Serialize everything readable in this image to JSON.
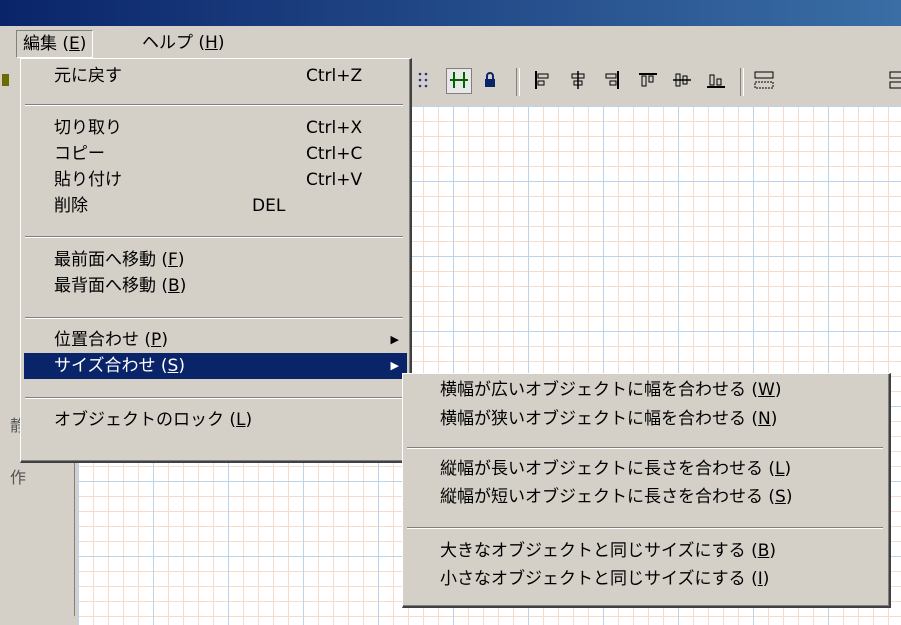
{
  "menubar": {
    "edit": {
      "label": "編集 (",
      "key": "E",
      "suffix": ")"
    },
    "help": {
      "label": "ヘルプ (",
      "key": "H",
      "suffix": ")"
    }
  },
  "toolbar": {
    "icons": [
      "grid-snap-icon",
      "fit-to-grid-icon",
      "lock-icon",
      "align-left-icon",
      "align-center-icon",
      "align-right-icon",
      "align-top-icon",
      "align-middle-icon",
      "align-bottom-icon",
      "same-size-icon"
    ]
  },
  "left_panel": {
    "text1": "静",
    "text2": "作"
  },
  "edit_menu": {
    "undo": {
      "label": "元に戻す",
      "shortcut": "Ctrl+Z"
    },
    "cut": {
      "label": "切り取り",
      "shortcut": "Ctrl+X"
    },
    "copy": {
      "label": "コピー",
      "shortcut": "Ctrl+C"
    },
    "paste": {
      "label": "貼り付け",
      "shortcut": "Ctrl+V"
    },
    "delete": {
      "label": "削除",
      "shortcut": "DEL"
    },
    "bring_front": {
      "label": "最前面へ移動 (",
      "key": "F",
      "suffix": ")"
    },
    "send_back": {
      "label": "最背面へ移動 (",
      "key": "B",
      "suffix": ")"
    },
    "align": {
      "label": "位置合わせ (",
      "key": "P",
      "suffix": ")"
    },
    "size_match": {
      "label": "サイズ合わせ (",
      "key": "S",
      "suffix": ")"
    },
    "lock": {
      "label": "オブジェクトのロック (",
      "key": "L",
      "suffix": ")"
    }
  },
  "size_submenu": {
    "width_wide": {
      "label": "横幅が広いオブジェクトに幅を合わせる (",
      "key": "W",
      "suffix": ")"
    },
    "width_narrow": {
      "label": "横幅が狭いオブジェクトに幅を合わせる (",
      "key": "N",
      "suffix": ")"
    },
    "height_long": {
      "label": "縦幅が長いオブジェクトに長さを合わせる (",
      "key": "L",
      "suffix": ")"
    },
    "height_short": {
      "label": "縦幅が短いオブジェクトに長さを合わせる (",
      "key": "S",
      "suffix": ")"
    },
    "same_large": {
      "label": "大きなオブジェクトと同じサイズにする (",
      "key": "B",
      "suffix": ")"
    },
    "same_small": {
      "label": "小さなオブジェクトと同じサイズにする (",
      "key": "I",
      "suffix": ")"
    }
  },
  "colors": {
    "highlight": "#0a246a",
    "face": "#d4d0c8",
    "grid_major": "#bcd3ec",
    "grid_minor": "#f6dccd"
  }
}
